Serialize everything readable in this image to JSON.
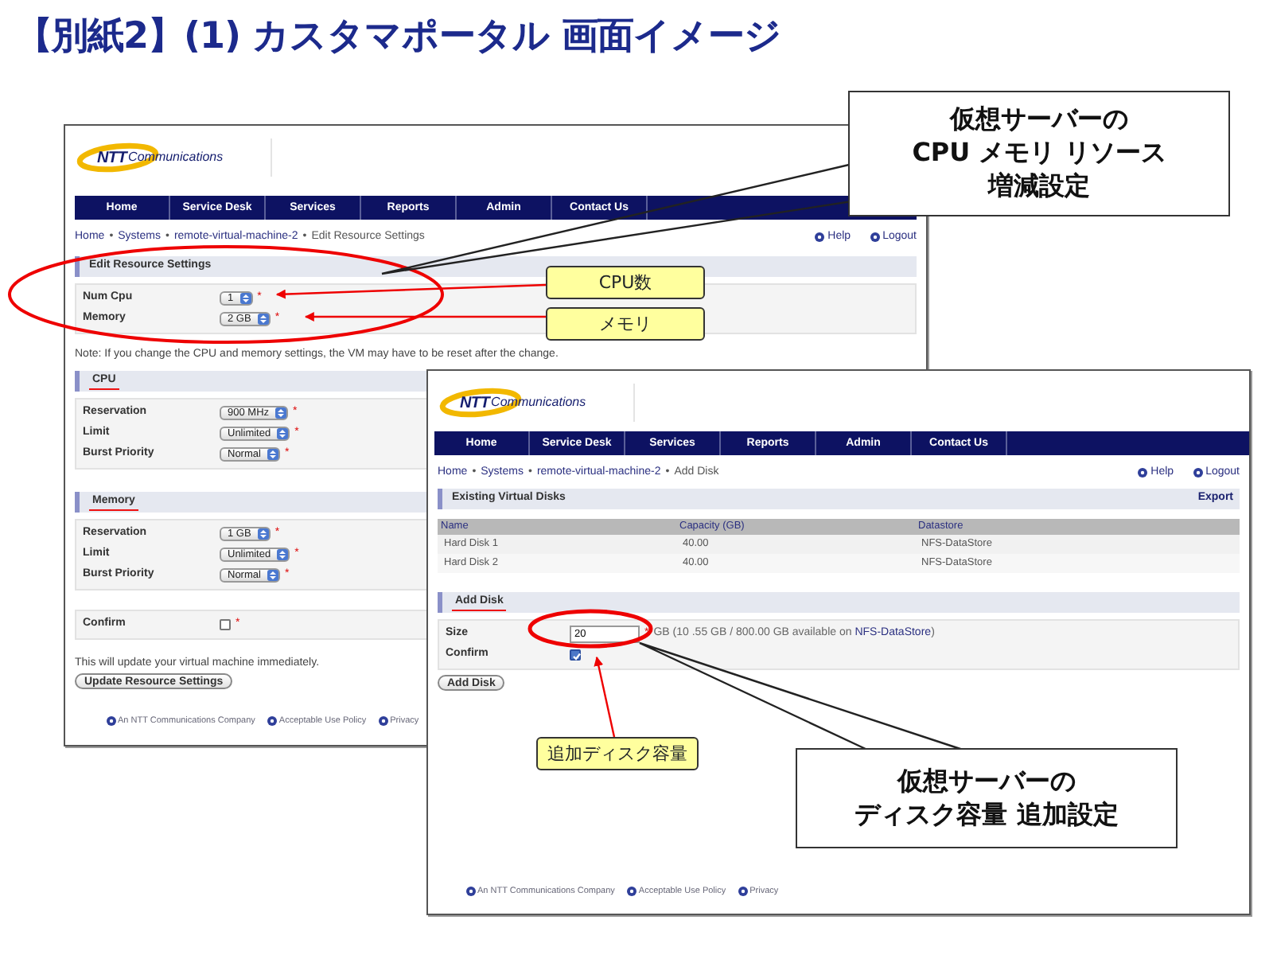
{
  "slide_title": "【別紙2】(1) カスタマポータル 画面イメージ",
  "required_symbol": "*",
  "breadcrumb_separator": "•",
  "resource_window": {
    "logo": {
      "brand": "NTT",
      "suffix": "Communications"
    },
    "nav": [
      "Home",
      "Service Desk",
      "Services",
      "Reports",
      "Admin",
      "Contact Us"
    ],
    "breadcrumb": [
      "Home",
      "Systems",
      "remote-virtual-machine-2",
      "Edit Resource Settings"
    ],
    "top_links": [
      "Help",
      "Logout"
    ],
    "sections": [
      {
        "title": "Edit Resource Settings",
        "underlined": false,
        "fields": [
          {
            "label": "Num Cpu",
            "value": "1",
            "required": true
          },
          {
            "label": "Memory",
            "value": "2 GB",
            "required": true
          }
        ],
        "note": "Note: If you change the CPU and memory settings, the VM may have to be reset after the change."
      },
      {
        "title": "CPU",
        "underlined": true,
        "fields": [
          {
            "label": "Reservation",
            "value": "900 MHz",
            "required": true
          },
          {
            "label": "Limit",
            "value": "Unlimited",
            "required": true
          },
          {
            "label": "Burst Priority",
            "value": "Normal",
            "required": true
          }
        ]
      },
      {
        "title": "Memory",
        "underlined": true,
        "fields": [
          {
            "label": "Reservation",
            "value": "1 GB",
            "required": true
          },
          {
            "label": "Limit",
            "value": "Unlimited",
            "required": true
          },
          {
            "label": "Burst Priority",
            "value": "Normal",
            "required": true
          }
        ]
      }
    ],
    "confirm": {
      "label": "Confirm",
      "checked": false,
      "required": true
    },
    "info": "This will update your virtual machine immediately.",
    "button": "Update Resource Settings",
    "footer": [
      "An NTT Communications Company",
      "Acceptable Use Policy",
      "Privacy"
    ]
  },
  "disk_window": {
    "logo": {
      "brand": "NTT",
      "suffix": "Communications"
    },
    "nav": [
      "Home",
      "Service Desk",
      "Services",
      "Reports",
      "Admin",
      "Contact Us"
    ],
    "breadcrumb": [
      "Home",
      "Systems",
      "remote-virtual-machine-2",
      "Add Disk"
    ],
    "top_links": [
      "Help",
      "Logout"
    ],
    "disks": {
      "title": "Existing Virtual Disks",
      "action": "Export",
      "columns": [
        "Name",
        "Capacity (GB)",
        "Datastore"
      ],
      "rows": [
        [
          "Hard Disk 1",
          "40.00",
          "NFS-DataStore"
        ],
        [
          "Hard Disk 2",
          "40.00",
          "NFS-DataStore"
        ]
      ]
    },
    "add": {
      "title": "Add Disk",
      "underlined": true,
      "size": {
        "label": "Size",
        "value": "20",
        "required": true,
        "hint": "GB (10 .55 GB / 800.00 GB available on ",
        "hint_link": "NFS-DataStore",
        "hint_end": ")"
      },
      "confirm": {
        "label": "Confirm",
        "checked": true
      },
      "button": "Add Disk"
    },
    "footer": [
      "An NTT Communications Company",
      "Acceptable Use Policy",
      "Privacy"
    ]
  },
  "annotations": {
    "callouts": [
      {
        "lines": [
          "仮想サーバーの",
          "CPU メモリ リソース",
          "増減設定"
        ]
      },
      {
        "lines": [
          "仮想サーバーの",
          "ディスク容量 追加設定"
        ]
      }
    ],
    "tags": [
      "CPU数",
      "メモリ",
      "追加ディスク容量"
    ]
  }
}
